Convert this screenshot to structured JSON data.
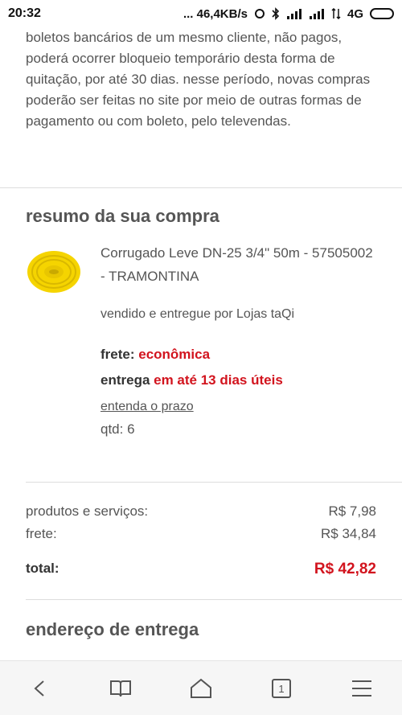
{
  "status_bar": {
    "time": "20:32",
    "speed": "... 46,4KB/s",
    "network": "4G"
  },
  "notice": {
    "text": "boletos bancários de um mesmo cliente, não pagos, poderá ocorrer bloqueio temporário desta forma de quitação, por até 30 dias. nesse período, novas compras poderão ser feitas no site por meio de outras formas de pagamento ou com boleto, pelo televendas."
  },
  "summary": {
    "title": "resumo da sua compra",
    "product": {
      "name": "Corrugado Leve DN-25 3/4\" 50m - 57505002 - TRAMONTINA",
      "seller": "vendido e entregue por Lojas taQi",
      "frete_label": "frete: ",
      "frete_value": "econômica",
      "entrega_label": "entrega ",
      "entrega_value": "em até 13 dias úteis",
      "prazo_link": "entenda o prazo",
      "qtd": "qtd: 6",
      "image_color": "#f5d400"
    }
  },
  "totals": {
    "produtos_label": "produtos e serviços:",
    "produtos_value": "R$ 7,98",
    "frete_label": "frete:",
    "frete_value": "R$ 34,84",
    "total_label": "total:",
    "total_value": "R$ 42,82"
  },
  "address": {
    "title": "endereço de entrega"
  },
  "bottom_nav": {
    "tab_count": "1",
    "icons": [
      "back-icon",
      "book-icon",
      "home-icon",
      "tabs-icon",
      "menu-icon"
    ]
  },
  "colors": {
    "accent_red": "#d2141e"
  }
}
